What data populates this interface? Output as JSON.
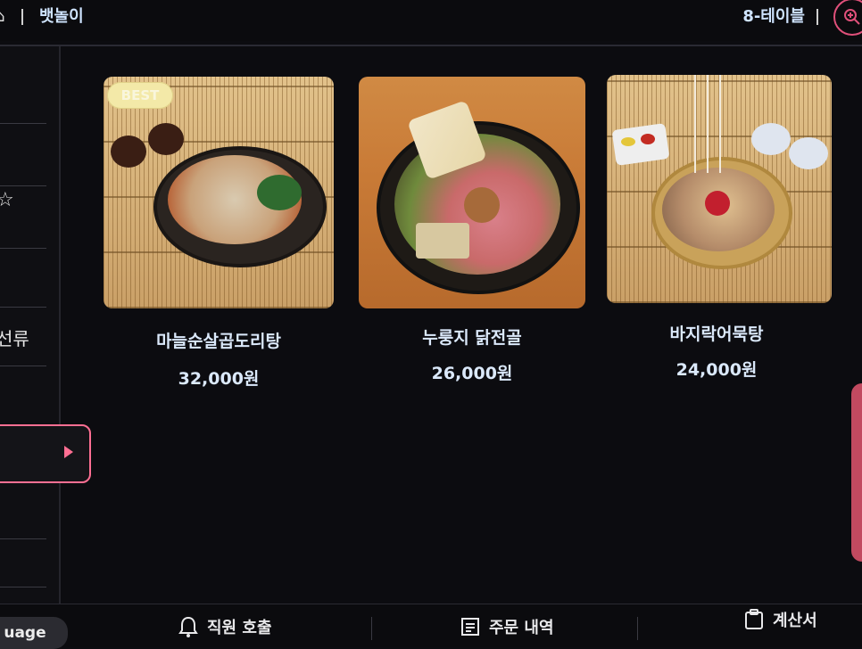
{
  "header": {
    "store_name": "뱃놀이",
    "table_label": "8-테이블"
  },
  "sidebar": {
    "star_label": "☆",
    "category_partial": "선류"
  },
  "menu": {
    "items": [
      {
        "name": "마늘순살곱도리탕",
        "price": "32,000원",
        "badge": "BEST"
      },
      {
        "name": "누룽지 닭전골",
        "price": "26,000원"
      },
      {
        "name": "바지락어묵탕",
        "price": "24,000원"
      }
    ]
  },
  "footer": {
    "language_label": "uage",
    "call_staff_label": "직원 호출",
    "order_history_label": "주문 내역",
    "bill_label": "계산서"
  },
  "colors": {
    "accent": "#ff6f93",
    "text_blue": "#dbe9fb"
  }
}
